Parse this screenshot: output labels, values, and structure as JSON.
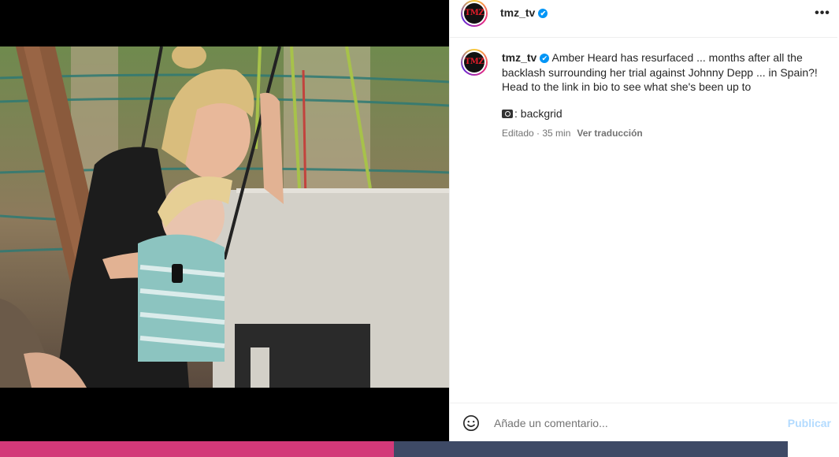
{
  "post": {
    "username": "tmz_tv",
    "logo_text": "TMZ",
    "verified_glyph": "✔",
    "more_glyph": "•••",
    "caption_user": "tmz_tv",
    "caption_text": "Amber Heard has resurfaced ... months after all the backlash surrounding her trial against Johnny Depp ... in Spain?! Head to the link in bio to see what she's been up to",
    "credit": ": backgrid",
    "edited": "Editado · 35 min",
    "translate_label": "Ver traducción"
  },
  "comment": {
    "placeholder": "Añade un comentario...",
    "publish_label": "Publicar"
  },
  "icons": {
    "more": "more-options-icon",
    "verified": "verified-badge-icon",
    "emoji": "emoji-icon",
    "camera": "camera-icon"
  },
  "colors": {
    "accent": "#0095f6",
    "publish_disabled": "#b3dbff",
    "text": "#262626",
    "secondary": "#737373",
    "tmz_red": "#e21d2a"
  }
}
